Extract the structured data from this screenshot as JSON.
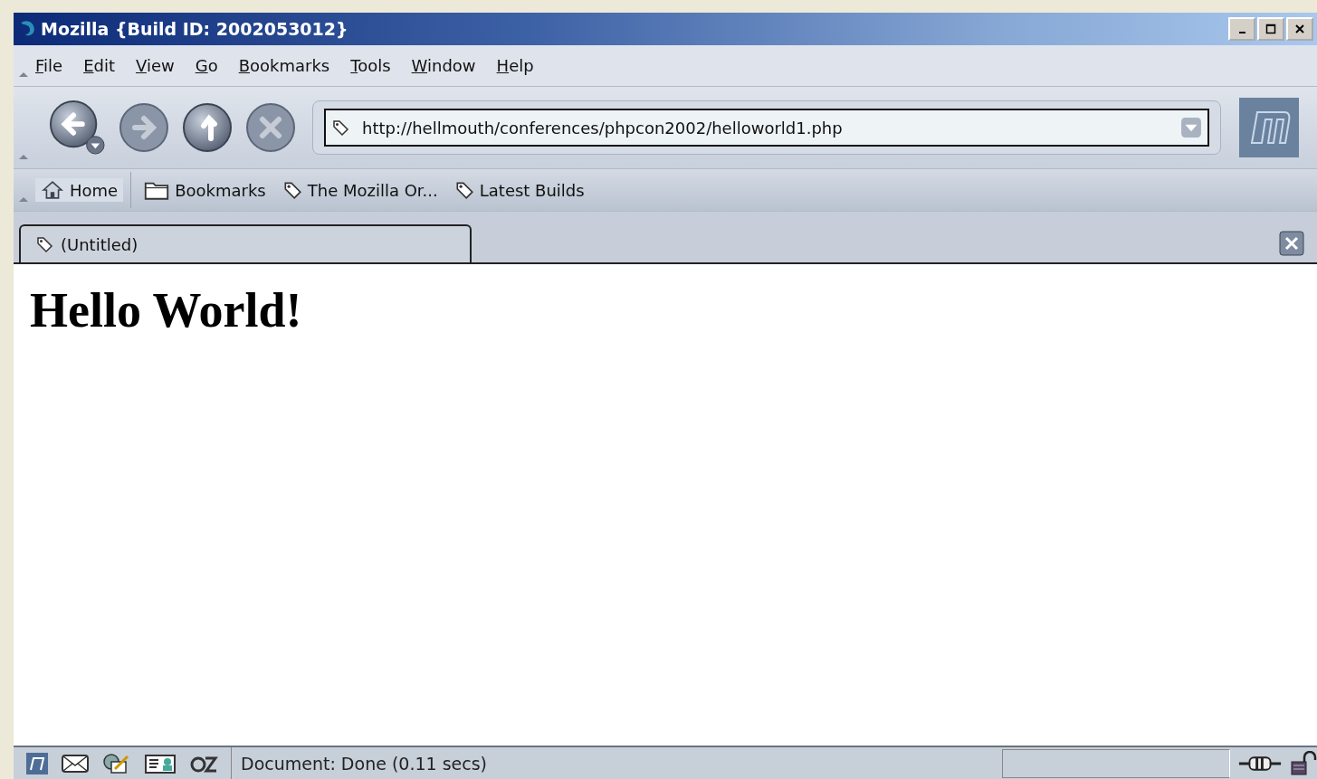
{
  "window": {
    "title": "Mozilla {Build ID: 2002053012}"
  },
  "menu": [
    "File",
    "Edit",
    "View",
    "Go",
    "Bookmarks",
    "Tools",
    "Window",
    "Help"
  ],
  "address": {
    "value": "http://hellmouth/conferences/phpcon2002/helloworld1.php"
  },
  "personal_bar": [
    {
      "kind": "home",
      "label": "Home"
    },
    {
      "kind": "folder",
      "label": "Bookmarks"
    },
    {
      "kind": "link",
      "label": "The Mozilla Or..."
    },
    {
      "kind": "link",
      "label": "Latest Builds"
    }
  ],
  "tabs": [
    {
      "label": "(Untitled)",
      "selected": true
    }
  ],
  "content": {
    "heading": "Hello World!"
  },
  "status_bar": {
    "text": "Document: Done (0.11 secs)"
  }
}
